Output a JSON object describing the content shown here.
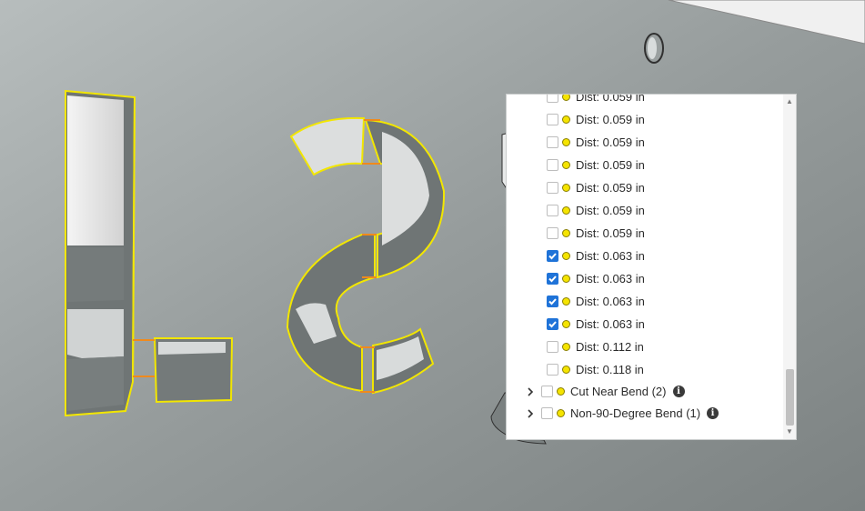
{
  "colors": {
    "face_highlight": "#f2e600",
    "bend_edge": "#f08a1c",
    "checkbox_checked": "#1f73d8",
    "indicator_dot": "#f5e400"
  },
  "panel": {
    "rows": [
      {
        "label": "Dist: 0.059 in",
        "checked": false
      },
      {
        "label": "Dist: 0.059 in",
        "checked": false
      },
      {
        "label": "Dist: 0.059 in",
        "checked": false
      },
      {
        "label": "Dist: 0.059 in",
        "checked": false
      },
      {
        "label": "Dist: 0.059 in",
        "checked": false
      },
      {
        "label": "Dist: 0.059 in",
        "checked": false
      },
      {
        "label": "Dist: 0.059 in",
        "checked": false
      },
      {
        "label": "Dist: 0.063 in",
        "checked": true
      },
      {
        "label": "Dist: 0.063 in",
        "checked": true
      },
      {
        "label": "Dist: 0.063 in",
        "checked": true
      },
      {
        "label": "Dist: 0.063 in",
        "checked": true
      },
      {
        "label": "Dist: 0.112 in",
        "checked": false
      },
      {
        "label": "Dist: 0.118 in",
        "checked": false
      }
    ],
    "groups": [
      {
        "label": "Cut Near Bend (2)",
        "checked": false,
        "icon": "info-icon"
      },
      {
        "label": "Non-90-Degree Bend (1)",
        "checked": false,
        "icon": "info-icon"
      }
    ],
    "scroll_up_glyph": "▲",
    "scroll_down_glyph": "▼",
    "info_glyph": "i"
  }
}
